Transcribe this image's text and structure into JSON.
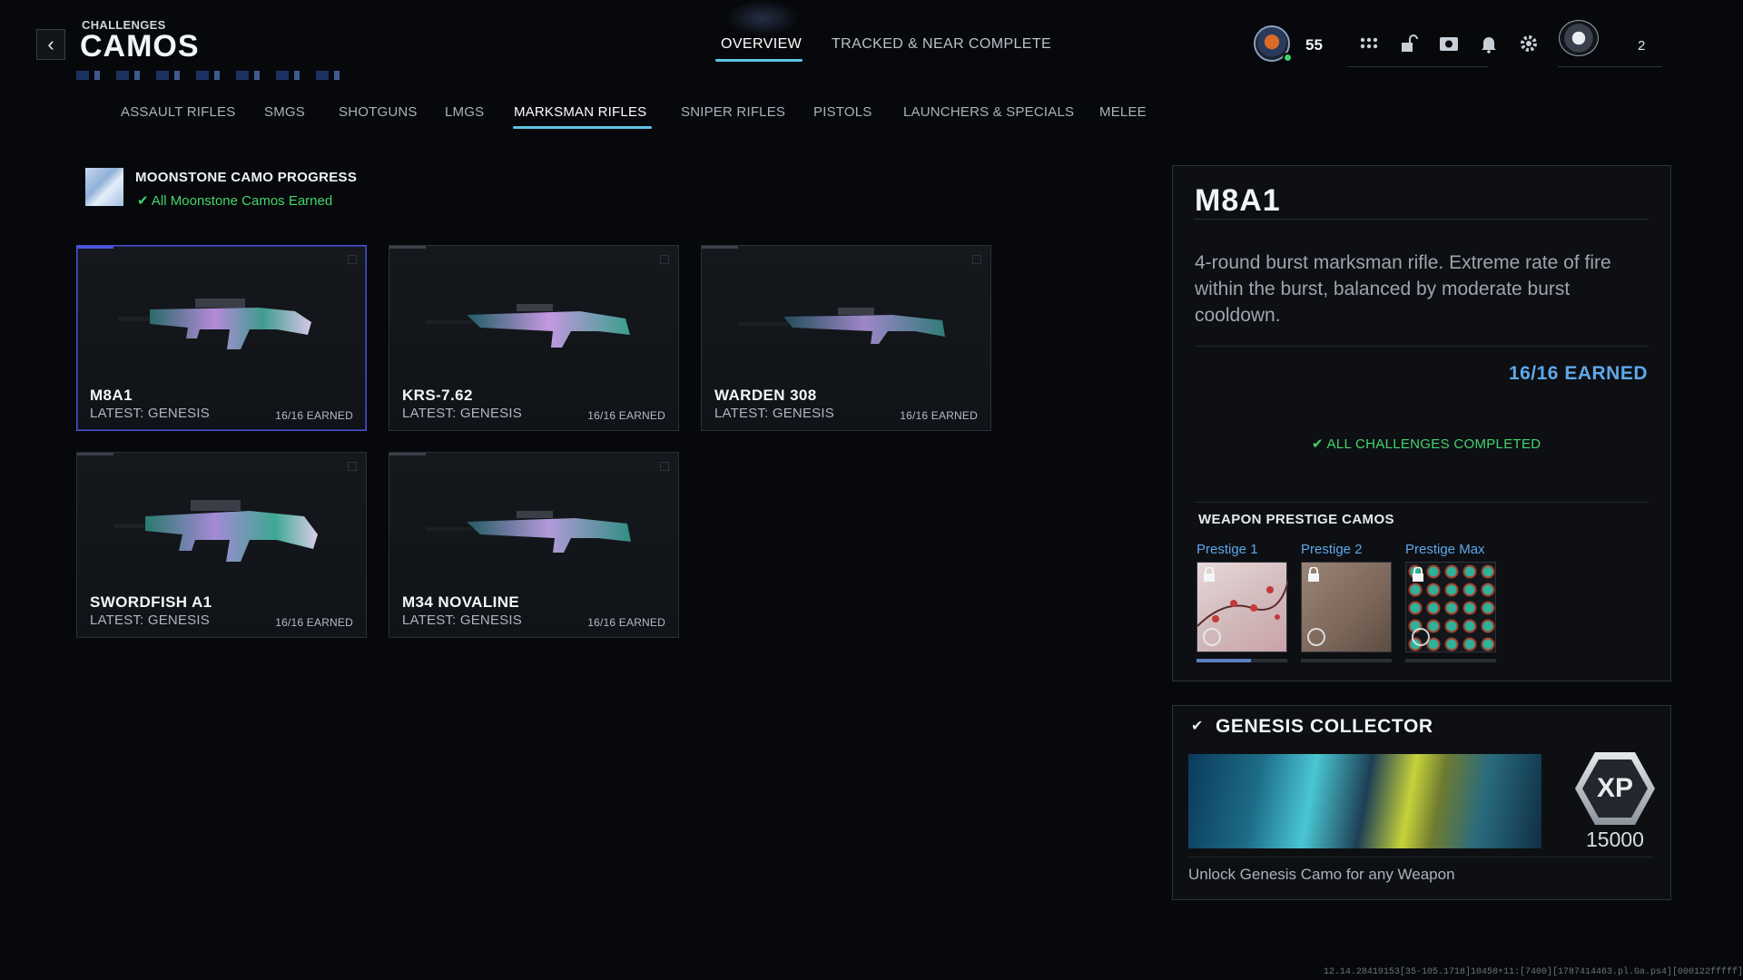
{
  "header": {
    "breadcrumb": "CHALLENGES",
    "title": "CAMOS",
    "back_icon": "chevron-left-icon",
    "tabs": [
      {
        "label": "OVERVIEW",
        "active": true
      },
      {
        "label": "TRACKED & NEAR COMPLETE",
        "active": false
      }
    ],
    "player_level": "55",
    "emblem_count": "2",
    "icons": [
      "grid-icon",
      "unlock-icon",
      "camera-icon",
      "bell-icon",
      "gear-icon"
    ]
  },
  "categories": [
    {
      "label": "ASSAULT RIFLES",
      "active": false
    },
    {
      "label": "SMGS",
      "active": false
    },
    {
      "label": "SHOTGUNS",
      "active": false
    },
    {
      "label": "LMGS",
      "active": false
    },
    {
      "label": "MARKSMAN RIFLES",
      "active": true
    },
    {
      "label": "SNIPER RIFLES",
      "active": false
    },
    {
      "label": "PISTOLS",
      "active": false
    },
    {
      "label": "LAUNCHERS & SPECIALS",
      "active": false
    },
    {
      "label": "MELEE",
      "active": false
    }
  ],
  "moonstone": {
    "title": "MOONSTONE CAMO PROGRESS",
    "status": "All Moonstone Camos Earned"
  },
  "weapons": [
    {
      "name": "M8A1",
      "latest": "LATEST: GENESIS",
      "earned": "16/16 EARNED",
      "selected": true
    },
    {
      "name": "KRS-7.62",
      "latest": "LATEST: GENESIS",
      "earned": "16/16 EARNED",
      "selected": false
    },
    {
      "name": "WARDEN 308",
      "latest": "LATEST: GENESIS",
      "earned": "16/16 EARNED",
      "selected": false
    },
    {
      "name": "SWORDFISH A1",
      "latest": "LATEST: GENESIS",
      "earned": "16/16 EARNED",
      "selected": false
    },
    {
      "name": "M34 NOVALINE",
      "latest": "LATEST: GENESIS",
      "earned": "16/16 EARNED",
      "selected": false
    }
  ],
  "detail": {
    "title": "M8A1",
    "description": "4-round burst marksman rifle. Extreme rate of fire within the burst, balanced by moderate burst cooldown.",
    "earned": "16/16 EARNED",
    "completed": "ALL CHALLENGES COMPLETED",
    "prestige_header": "WEAPON PRESTIGE CAMOS",
    "prestige": [
      {
        "label": "Prestige 1",
        "progress": 0.6
      },
      {
        "label": "Prestige 2",
        "progress": 0
      },
      {
        "label": "Prestige Max",
        "progress": 0
      }
    ]
  },
  "collector": {
    "title": "GENESIS COLLECTOR",
    "xp_label": "XP",
    "xp_value": "15000",
    "description": "Unlock Genesis Camo for any Weapon"
  },
  "build_info": "12.14.28419153[35-105.1718]10458+11:[7400][1787414463.pl.Ga.ps4][000122fffff]"
}
